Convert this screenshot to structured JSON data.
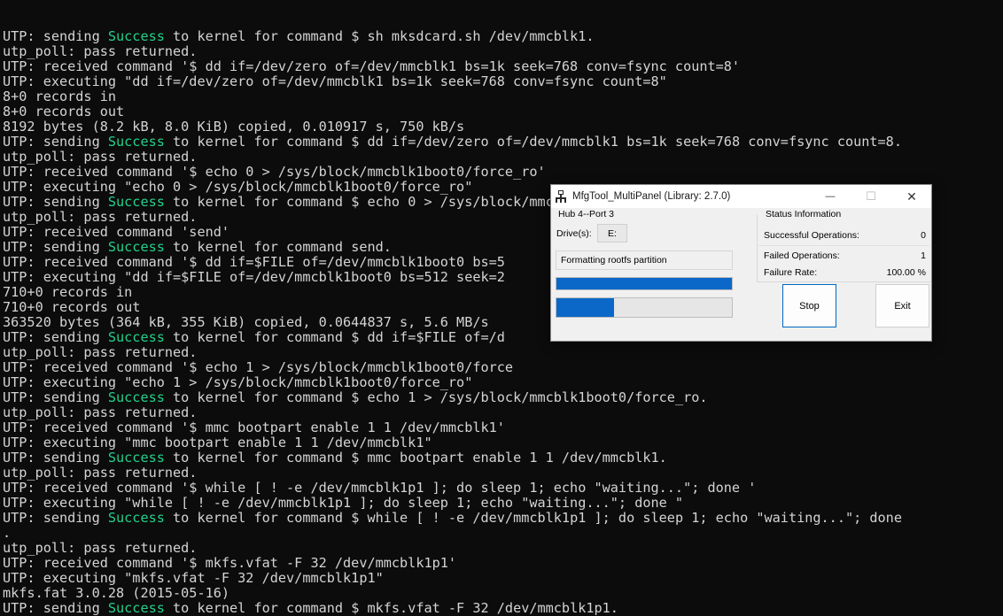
{
  "terminal": {
    "lines": [
      [
        {
          "t": "UTP: sending "
        },
        {
          "t": "Success",
          "c": "ok"
        },
        {
          "t": " to kernel for command $ sh mksdcard.sh /dev/mmcblk1."
        }
      ],
      [
        {
          "t": "utp_poll: pass returned."
        }
      ],
      [
        {
          "t": "UTP: received command '$ dd if=/dev/zero of=/dev/mmcblk1 bs=1k seek=768 conv=fsync count=8'"
        }
      ],
      [
        {
          "t": "UTP: executing \"dd if=/dev/zero of=/dev/mmcblk1 bs=1k seek=768 conv=fsync count=8\""
        }
      ],
      [
        {
          "t": "8+0 records in"
        }
      ],
      [
        {
          "t": "8+0 records out"
        }
      ],
      [
        {
          "t": "8192 bytes (8.2 kB, 8.0 KiB) copied, 0.010917 s, 750 kB/s"
        }
      ],
      [
        {
          "t": "UTP: sending "
        },
        {
          "t": "Success",
          "c": "ok"
        },
        {
          "t": " to kernel for command $ dd if=/dev/zero of=/dev/mmcblk1 bs=1k seek=768 conv=fsync count=8."
        }
      ],
      [
        {
          "t": "utp_poll: pass returned."
        }
      ],
      [
        {
          "t": "UTP: received command '$ echo 0 > /sys/block/mmcblk1boot0/force_ro'"
        }
      ],
      [
        {
          "t": "UTP: executing \"echo 0 > /sys/block/mmcblk1boot0/force_ro\""
        }
      ],
      [
        {
          "t": "UTP: sending "
        },
        {
          "t": "Success",
          "c": "ok"
        },
        {
          "t": " to kernel for command $ echo 0 > /sys/block/mmcblk1boot0/force_ro."
        }
      ],
      [
        {
          "t": "utp_poll: pass returned."
        }
      ],
      [
        {
          "t": "UTP: received command 'send'"
        }
      ],
      [
        {
          "t": "UTP: sending "
        },
        {
          "t": "Success",
          "c": "ok"
        },
        {
          "t": " to kernel for command send."
        }
      ],
      [
        {
          "t": "UTP: received command '$ dd if=$FILE of=/dev/mmcblk1boot0 bs=5"
        }
      ],
      [
        {
          "t": "UTP: executing \"dd if=$FILE of=/dev/mmcblk1boot0 bs=512 seek=2"
        }
      ],
      [
        {
          "t": "710+0 records in"
        }
      ],
      [
        {
          "t": "710+0 records out"
        }
      ],
      [
        {
          "t": "363520 bytes (364 kB, 355 KiB) copied, 0.0644837 s, 5.6 MB/s"
        }
      ],
      [
        {
          "t": "UTP: sending "
        },
        {
          "t": "Success",
          "c": "ok"
        },
        {
          "t": " to kernel for command $ dd if=$FILE of=/d"
        }
      ],
      [
        {
          "t": "utp_poll: pass returned."
        }
      ],
      [
        {
          "t": "UTP: received command '$ echo 1 > /sys/block/mmcblk1boot0/force"
        }
      ],
      [
        {
          "t": "UTP: executing \"echo 1 > /sys/block/mmcblk1boot0/force_ro\""
        }
      ],
      [
        {
          "t": "UTP: sending "
        },
        {
          "t": "Success",
          "c": "ok"
        },
        {
          "t": " to kernel for command $ echo 1 > /sys/block/mmcblk1boot0/force_ro."
        }
      ],
      [
        {
          "t": "utp_poll: pass returned."
        }
      ],
      [
        {
          "t": "UTP: received command '$ mmc bootpart enable 1 1 /dev/mmcblk1'"
        }
      ],
      [
        {
          "t": "UTP: executing \"mmc bootpart enable 1 1 /dev/mmcblk1\""
        }
      ],
      [
        {
          "t": "UTP: sending "
        },
        {
          "t": "Success",
          "c": "ok"
        },
        {
          "t": " to kernel for command $ mmc bootpart enable 1 1 /dev/mmcblk1."
        }
      ],
      [
        {
          "t": "utp_poll: pass returned."
        }
      ],
      [
        {
          "t": "UTP: received command '$ while [ ! -e /dev/mmcblk1p1 ]; do sleep 1; echo \"waiting...\"; done '"
        }
      ],
      [
        {
          "t": "UTP: executing \"while [ ! -e /dev/mmcblk1p1 ]; do sleep 1; echo \"waiting...\"; done \""
        }
      ],
      [
        {
          "t": "UTP: sending "
        },
        {
          "t": "Success",
          "c": "ok"
        },
        {
          "t": " to kernel for command $ while [ ! -e /dev/mmcblk1p1 ]; do sleep 1; echo \"waiting...\"; done"
        }
      ],
      [
        {
          "t": "."
        }
      ],
      [
        {
          "t": "utp_poll: pass returned."
        }
      ],
      [
        {
          "t": "UTP: received command '$ mkfs.vfat -F 32 /dev/mmcblk1p1'"
        }
      ],
      [
        {
          "t": "UTP: executing \"mkfs.vfat -F 32 /dev/mmcblk1p1\""
        }
      ],
      [
        {
          "t": "mkfs.fat 3.0.28 (2015-05-16)"
        }
      ],
      [
        {
          "t": "UTP: sending "
        },
        {
          "t": "Success",
          "c": "ok"
        },
        {
          "t": " to kernel for command $ mkfs.vfat -F 32 /dev/mmcblk1p1."
        }
      ]
    ]
  },
  "dialog": {
    "title": "MfgTool_MultiPanel (Library: 2.7.0)",
    "hub_label": "Hub 4--Port 3",
    "drives_label": "Drive(s):",
    "drive_value": "E:",
    "status_text": "Formatting rootfs partition",
    "progress_total": 1.0,
    "progress_current": 0.33,
    "status_group_label": "Status Information",
    "stats": {
      "successful_label": "Successful Operations:",
      "successful_value": "0",
      "failed_label": "Failed Operations:",
      "failed_value": "1",
      "failure_rate_label": "Failure Rate:",
      "failure_rate_value": "100.00 %"
    },
    "stop_label": "Stop",
    "exit_label": "Exit",
    "min_glyph": "—",
    "max_glyph": "☐",
    "close_glyph": "✕"
  }
}
